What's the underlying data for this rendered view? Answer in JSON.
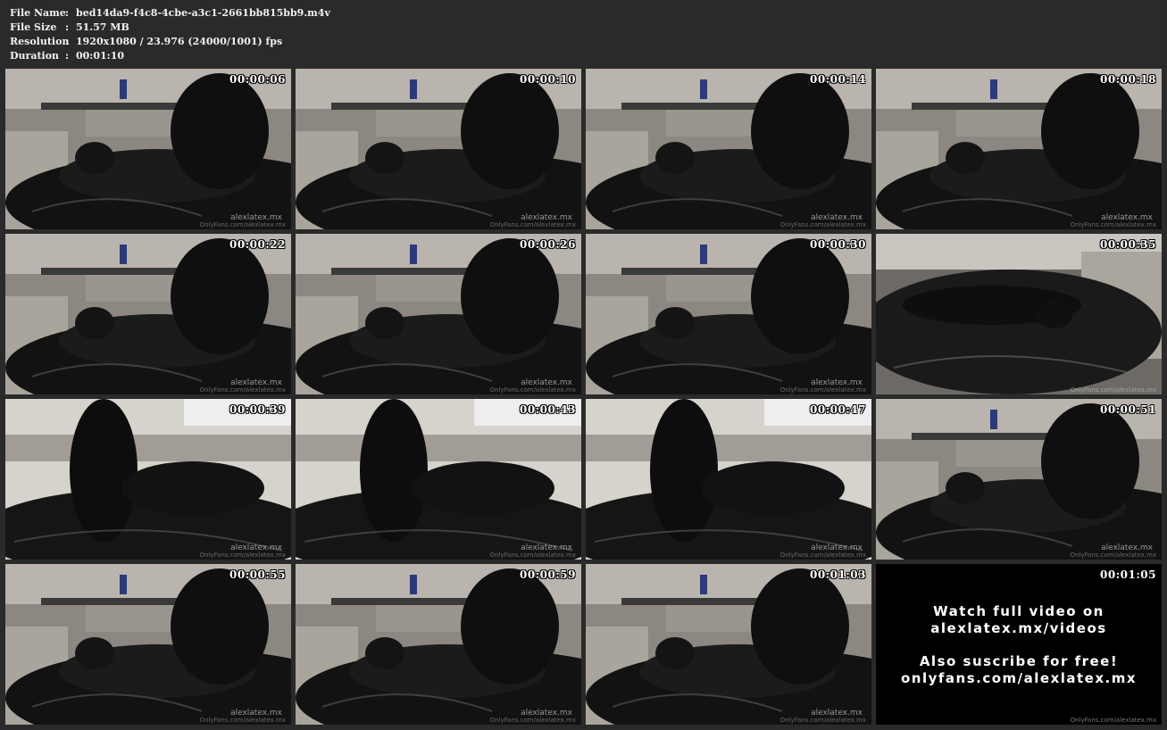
{
  "info": {
    "rows": [
      {
        "key": "File Name",
        "sep": ":",
        "value": "bed14da9-f4c8-4cbe-a3c1-2661bb815bb9.m4v"
      },
      {
        "key": "File Size",
        "sep": ":",
        "value": "51.57 MB"
      },
      {
        "key": "Resolution",
        "sep": ":",
        "value": "1920x1080 / 23.976 (24000/1001) fps"
      },
      {
        "key": "Duration",
        "sep": ":",
        "value": "00:01:10"
      }
    ]
  },
  "thumbnails": [
    {
      "timestamp": "00:00:06",
      "watermark": "alexlatex.mx",
      "watermark_small": "OnlyFans.com/alexlatex.mx",
      "scene": "sofa"
    },
    {
      "timestamp": "00:00:10",
      "watermark": "alexlatex.mx",
      "watermark_small": "OnlyFans.com/alexlatex.mx",
      "scene": "sofa"
    },
    {
      "timestamp": "00:00:14",
      "watermark": "alexlatex.mx",
      "watermark_small": "OnlyFans.com/alexlatex.mx",
      "scene": "sofa"
    },
    {
      "timestamp": "00:00:18",
      "watermark": "alexlatex.mx",
      "watermark_small": "OnlyFans.com/alexlatex.mx",
      "scene": "sofa"
    },
    {
      "timestamp": "00:00:22",
      "watermark": "alexlatex.mx",
      "watermark_small": "OnlyFans.com/alexlatex.mx",
      "scene": "sofa"
    },
    {
      "timestamp": "00:00:26",
      "watermark": "alexlatex.mx",
      "watermark_small": "OnlyFans.com/alexlatex.mx",
      "scene": "sofa"
    },
    {
      "timestamp": "00:00:30",
      "watermark": "alexlatex.mx",
      "watermark_small": "OnlyFans.com/alexlatex.mx",
      "scene": "sofa"
    },
    {
      "timestamp": "00:00:35",
      "watermark": "",
      "watermark_small": "OnlyFans.com/alexlatex.mx",
      "scene": "overhead"
    },
    {
      "timestamp": "00:00:39",
      "watermark": "alexlatex.mx",
      "watermark_small": "OnlyFans.com/alexlatex.mx",
      "scene": "wall"
    },
    {
      "timestamp": "00:00:43",
      "watermark": "alexlatex.mx",
      "watermark_small": "OnlyFans.com/alexlatex.mx",
      "scene": "wall"
    },
    {
      "timestamp": "00:00:47",
      "watermark": "alexlatex.mx",
      "watermark_small": "OnlyFans.com/alexlatex.mx",
      "scene": "wall"
    },
    {
      "timestamp": "00:00:51",
      "watermark": "alexlatex.mx",
      "watermark_small": "OnlyFans.com/alexlatex.mx",
      "scene": "sofa"
    },
    {
      "timestamp": "00:00:55",
      "watermark": "alexlatex.mx",
      "watermark_small": "OnlyFans.com/alexlatex.mx",
      "scene": "sofa"
    },
    {
      "timestamp": "00:00:59",
      "watermark": "alexlatex.mx",
      "watermark_small": "OnlyFans.com/alexlatex.mx",
      "scene": "sofa"
    },
    {
      "timestamp": "00:01:03",
      "watermark": "alexlatex.mx",
      "watermark_small": "OnlyFans.com/alexlatex.mx",
      "scene": "sofa"
    }
  ],
  "promo": {
    "timestamp": "00:01:05",
    "line1": "Watch full video on",
    "line2": "alexlatex.mx/videos",
    "line3": "Also suscribe for free!",
    "line4": "onlyfans.com/alexlatex.mx",
    "watermark_small": "OnlyFans.com/alexlatex.mx"
  },
  "colors": {
    "background": "#2a2a2a",
    "text": "#f2f2f2",
    "promo_background": "#000000"
  }
}
